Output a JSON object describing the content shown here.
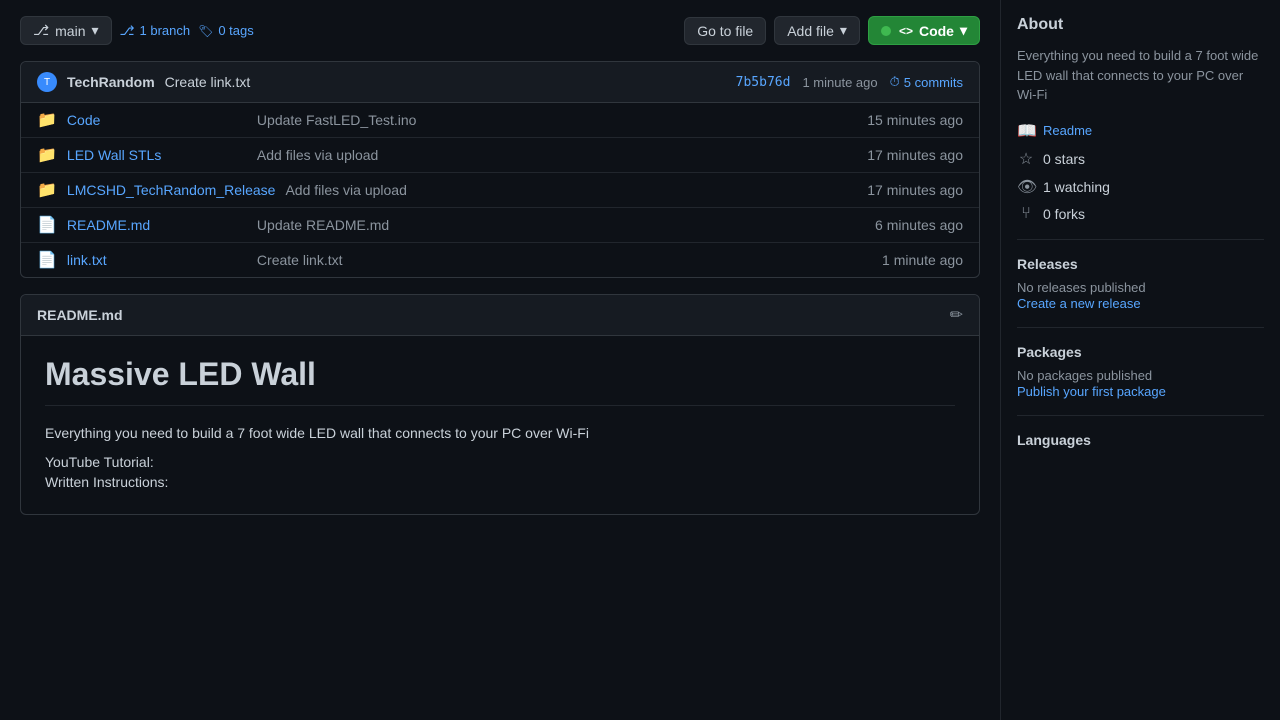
{
  "toolbar": {
    "branch_label": "main",
    "branch_icon": "branch-icon",
    "branch_count": "1 branch",
    "tags_count": "0 tags",
    "go_to_file": "Go to file",
    "add_file": "Add file",
    "add_file_chevron": "▾",
    "code_label": "Code",
    "code_chevron": "▾"
  },
  "commit_bar": {
    "author": "TechRandom",
    "message": "Create link.txt",
    "hash": "7b5b76d",
    "time": "1 minute ago",
    "commits_count": "5 commits"
  },
  "files": [
    {
      "type": "folder",
      "name": "Code",
      "commit": "Update FastLED_Test.ino",
      "time": "15 minutes ago"
    },
    {
      "type": "folder",
      "name": "LED Wall STLs",
      "commit": "Add files via upload",
      "time": "17 minutes ago"
    },
    {
      "type": "folder",
      "name": "LMCSHD_TechRandom_Release",
      "commit": "Add files via upload",
      "time": "17 minutes ago"
    },
    {
      "type": "file",
      "name": "README.md",
      "commit": "Update README.md",
      "time": "6 minutes ago"
    },
    {
      "type": "file",
      "name": "link.txt",
      "commit": "Create link.txt",
      "time": "1 minute ago"
    }
  ],
  "readme": {
    "header": "README.md",
    "title": "Massive LED Wall",
    "description": "Everything you need to build a 7 foot wide LED wall that connects to your PC over Wi-Fi",
    "youtube_label": "YouTube Tutorial:",
    "written_label": "Written Instructions:"
  },
  "sidebar": {
    "about_title": "About",
    "about_desc": "Everything you need to build a 7 foot wide LED wall that connects to your PC over Wi-Fi",
    "readme_label": "Readme",
    "stars": "0 stars",
    "watching": "1 watching",
    "forks": "0 forks",
    "releases_title": "Releases",
    "releases_note": "No releases published",
    "releases_link": "Create a new release",
    "packages_title": "Packages",
    "packages_note": "No packages published",
    "packages_link": "Publish your first package",
    "languages_title": "Languages"
  }
}
